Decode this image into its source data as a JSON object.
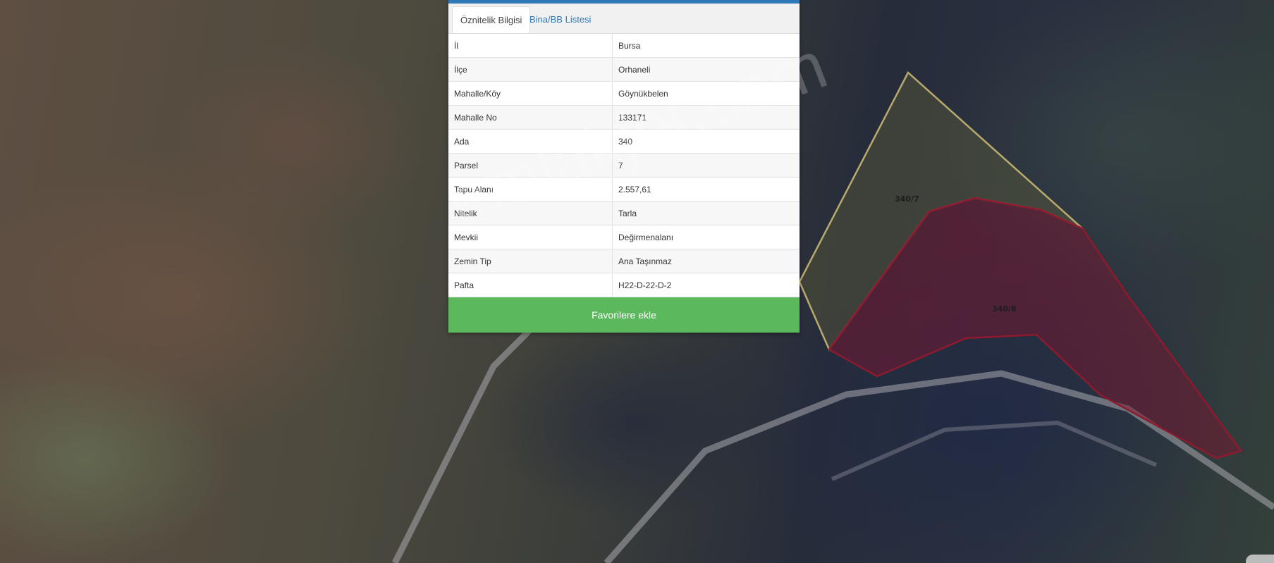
{
  "tabs": [
    {
      "label": "Öznitelik Bilgisi",
      "active": true
    },
    {
      "label": "Bina/BB Listesi",
      "active": false
    }
  ],
  "attributes": [
    {
      "key": "İl",
      "value": "Bursa"
    },
    {
      "key": "İlçe",
      "value": "Orhaneli"
    },
    {
      "key": "Mahalle/Köy",
      "value": "Göynükbelen"
    },
    {
      "key": "Mahalle No",
      "value": "133171"
    },
    {
      "key": "Ada",
      "value": "340"
    },
    {
      "key": "Parsel",
      "value": "7"
    },
    {
      "key": "Tapu Alanı",
      "value": "2.557,61"
    },
    {
      "key": "Nitelik",
      "value": "Tarla"
    },
    {
      "key": "Mevkii",
      "value": "Değirmenalanı"
    },
    {
      "key": "Zemin Tip",
      "value": "Ana Taşınmaz"
    },
    {
      "key": "Pafta",
      "value": "H22-D-22-D-2"
    }
  ],
  "favorite_button": "Favorilere ekle",
  "watermark": "emlakjet.com",
  "map": {
    "parcels": [
      {
        "label": "340/7",
        "outline_color": "#b9ab6e",
        "fill_color": "#5a5a3a"
      },
      {
        "label": "340/8",
        "outline_color": "#8e1a2e",
        "fill_color": "#7a1630"
      }
    ]
  },
  "colors": {
    "accent": "#2f78b8",
    "button": "#5cb85c"
  }
}
